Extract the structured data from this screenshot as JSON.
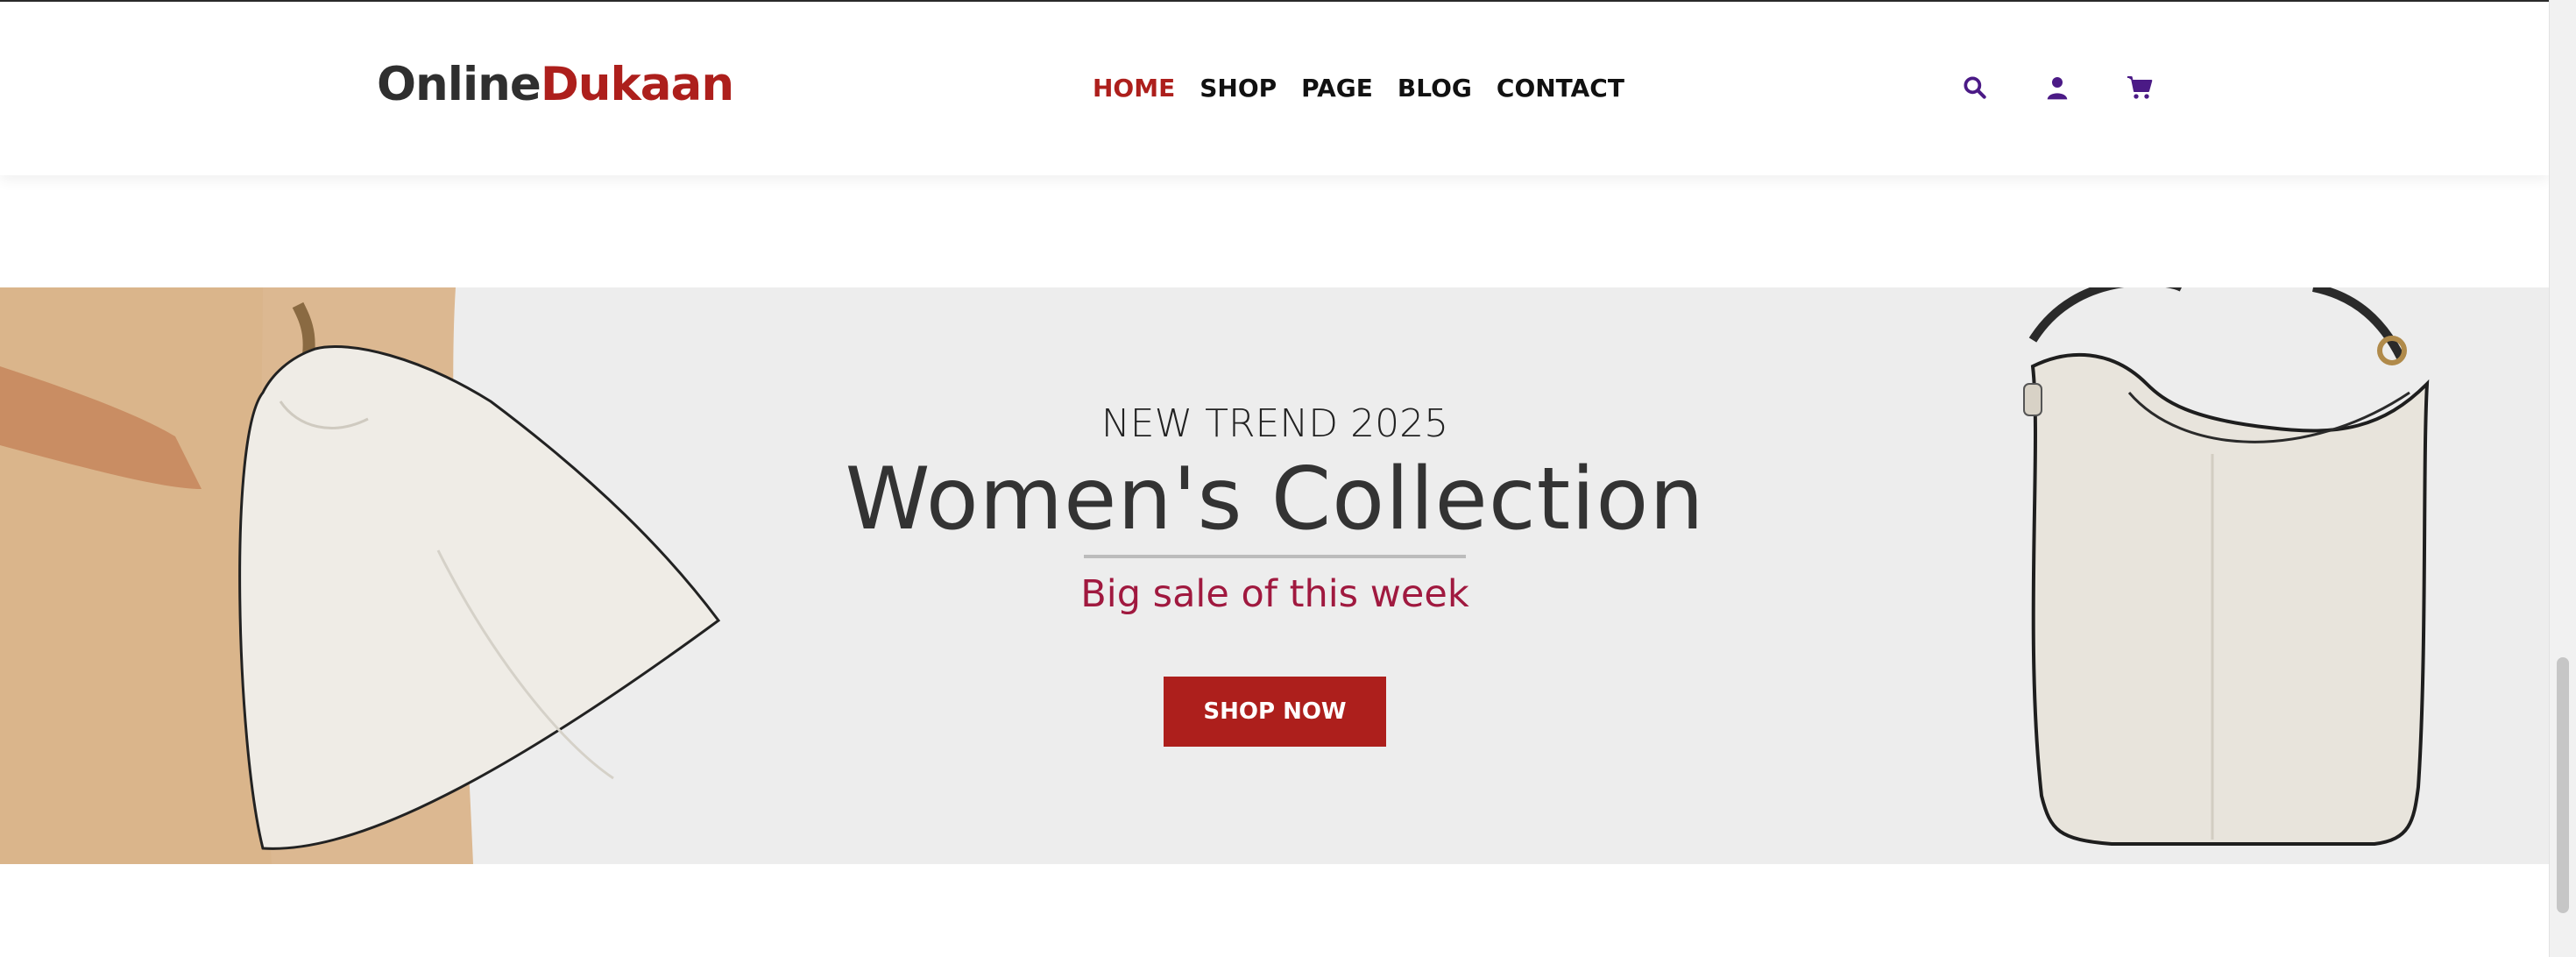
{
  "brand": {
    "part1": "Online",
    "part2": "Dukaan"
  },
  "nav": [
    {
      "label": "HOME",
      "active": true
    },
    {
      "label": "SHOP",
      "active": false
    },
    {
      "label": "PAGE",
      "active": false
    },
    {
      "label": "BLOG",
      "active": false
    },
    {
      "label": "CONTACT",
      "active": false
    }
  ],
  "header_icons": [
    "search-icon",
    "user-icon",
    "cart-icon"
  ],
  "hero": {
    "kicker": "NEW TREND 2025",
    "title": "Women's Collection",
    "subtitle": "Big sale of this week",
    "cta": "SHOP NOW"
  },
  "colors": {
    "brand_red": "#ad1f1c",
    "subtitle": "#a0193f",
    "icon": "#4b1a86",
    "hero_bg": "#ededed"
  }
}
